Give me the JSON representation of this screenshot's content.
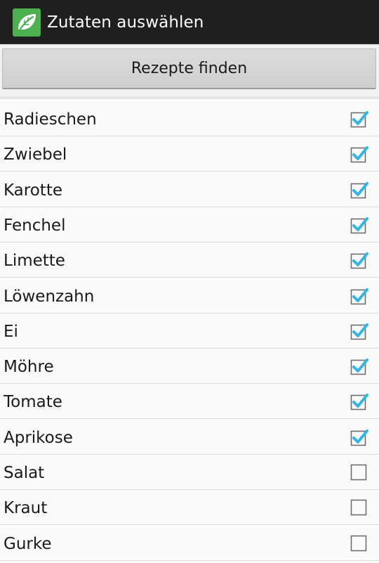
{
  "action_bar": {
    "title": "Zutaten auswählen",
    "app_icon": "leaf-app-icon",
    "app_icon_color": "#4caf50"
  },
  "find_button": {
    "label": "Rezepte finden"
  },
  "accent_color": "#33b5e5",
  "ingredients": [
    {
      "name": "Radieschen",
      "checked": true
    },
    {
      "name": "Zwiebel",
      "checked": true
    },
    {
      "name": "Karotte",
      "checked": true
    },
    {
      "name": "Fenchel",
      "checked": true
    },
    {
      "name": "Limette",
      "checked": true
    },
    {
      "name": "Löwenzahn",
      "checked": true
    },
    {
      "name": "Ei",
      "checked": true
    },
    {
      "name": "Möhre",
      "checked": true
    },
    {
      "name": "Tomate",
      "checked": true
    },
    {
      "name": "Aprikose",
      "checked": true
    },
    {
      "name": "Salat",
      "checked": false
    },
    {
      "name": "Kraut",
      "checked": false
    },
    {
      "name": "Gurke",
      "checked": false
    }
  ]
}
